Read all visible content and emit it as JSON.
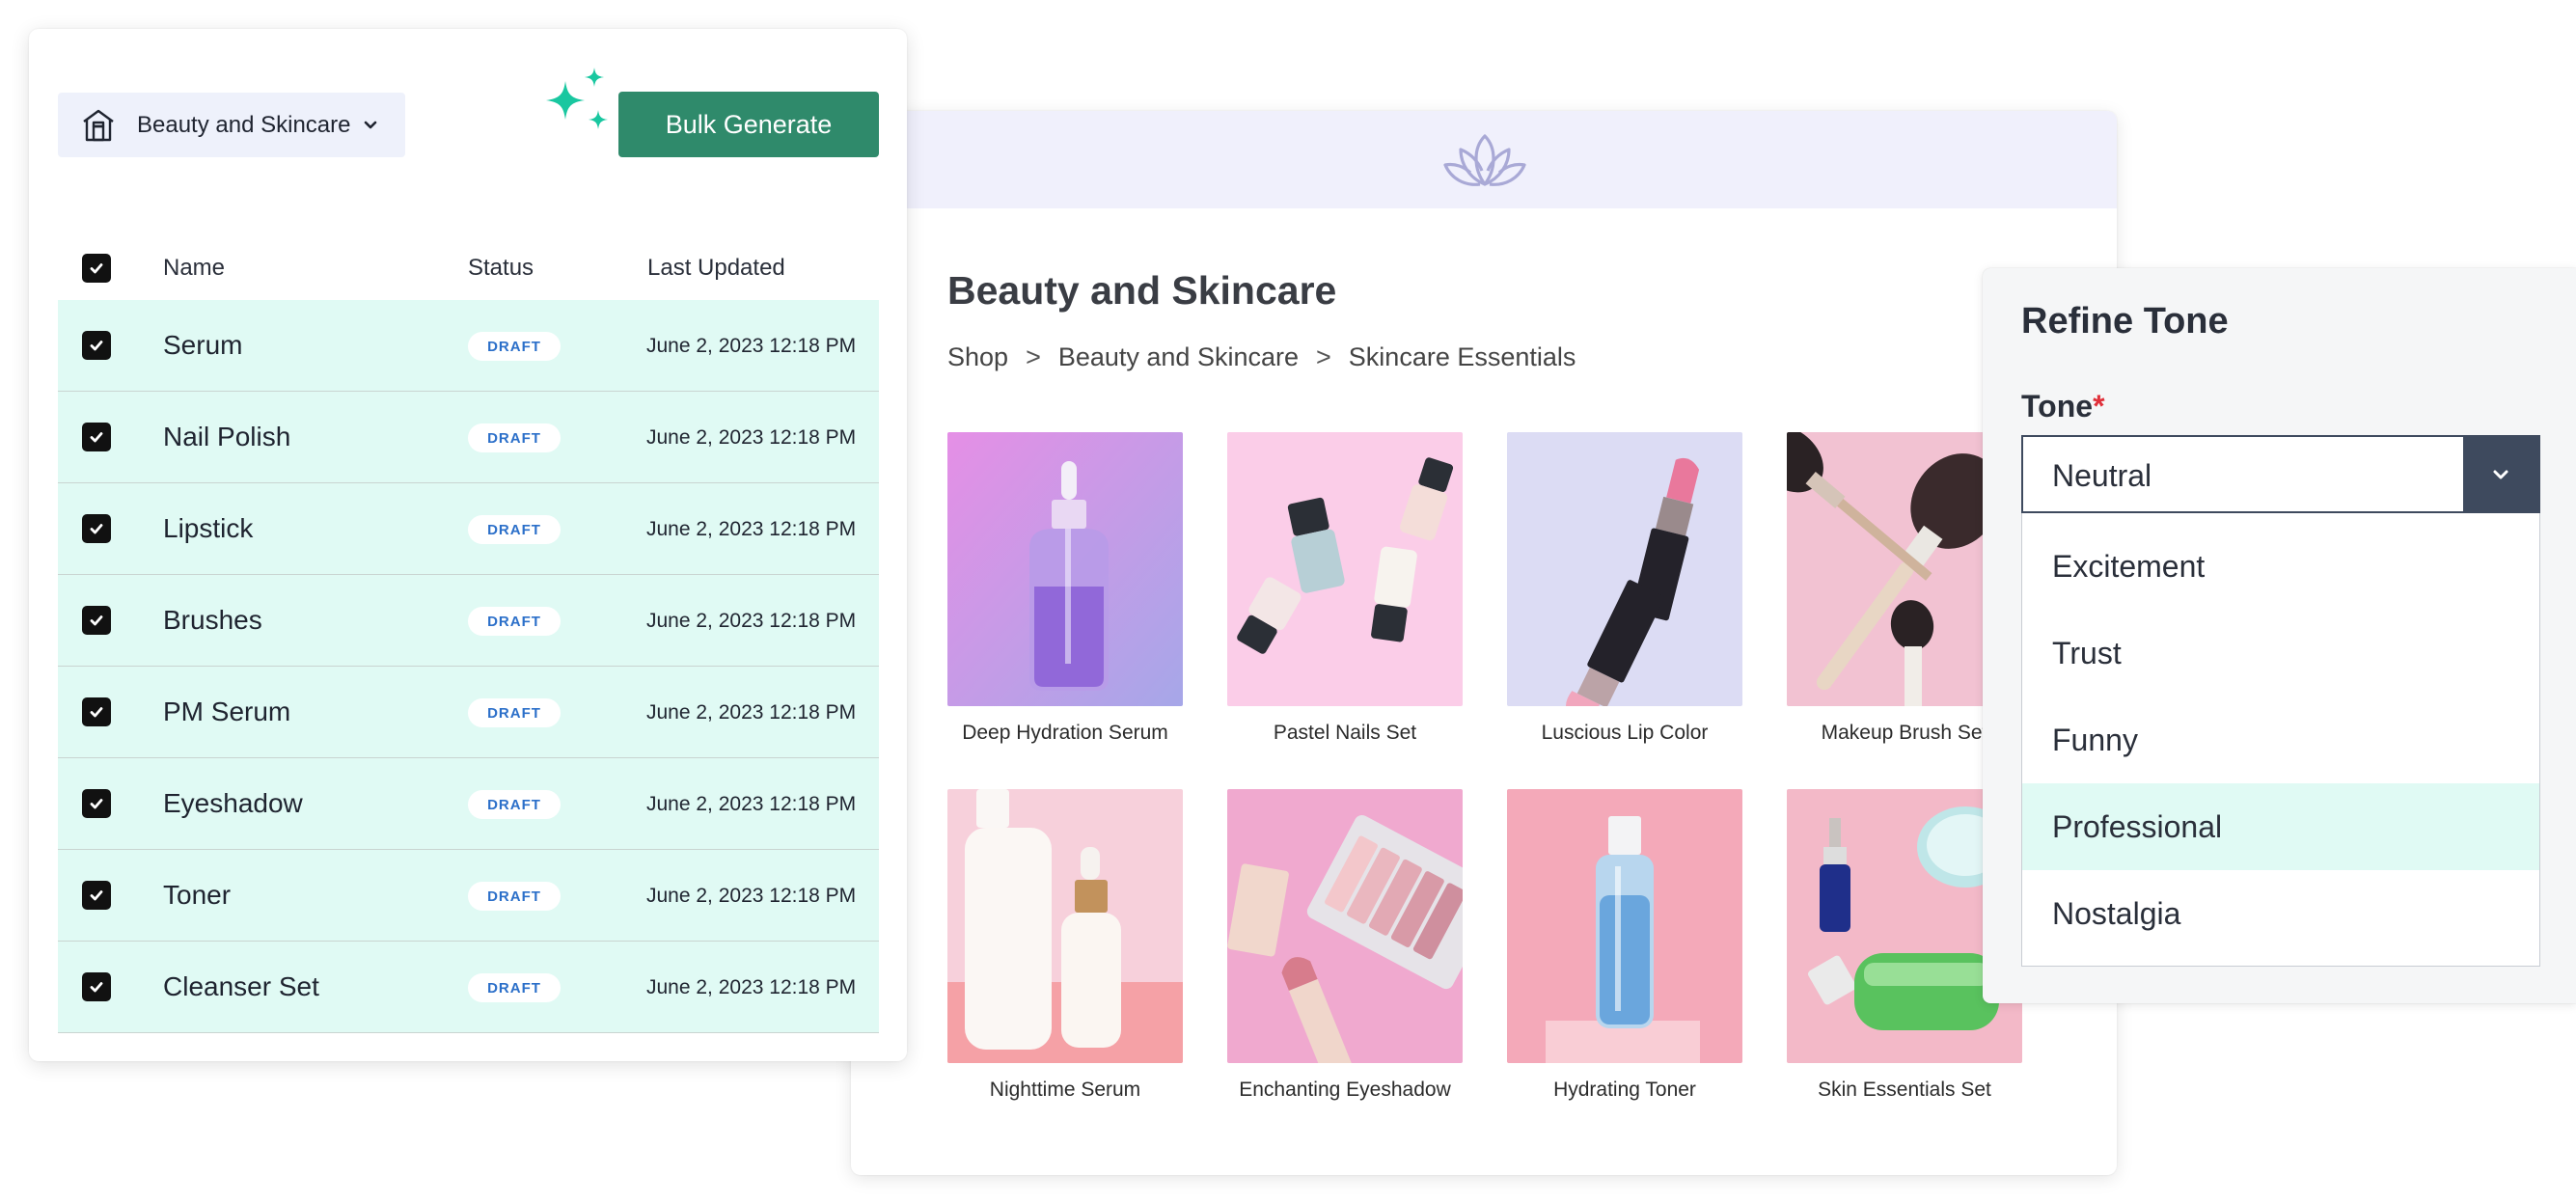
{
  "product_list": {
    "store_select": {
      "label": "Beauty and Skincare"
    },
    "bulk_generate_label": "Bulk Generate",
    "columns": {
      "name": "Name",
      "status": "Status",
      "last_updated": "Last Updated"
    },
    "rows": [
      {
        "name": "Serum",
        "status": "DRAFT",
        "updated": "June 2, 2023  12:18 PM"
      },
      {
        "name": "Nail Polish",
        "status": "DRAFT",
        "updated": "June 2, 2023  12:18 PM"
      },
      {
        "name": "Lipstick",
        "status": "DRAFT",
        "updated": "June 2, 2023  12:18 PM"
      },
      {
        "name": "Brushes",
        "status": "DRAFT",
        "updated": "June 2, 2023  12:18 PM"
      },
      {
        "name": "PM Serum",
        "status": "DRAFT",
        "updated": "June 2, 2023  12:18 PM"
      },
      {
        "name": "Eyeshadow",
        "status": "DRAFT",
        "updated": "June 2, 2023  12:18 PM"
      },
      {
        "name": "Toner",
        "status": "DRAFT",
        "updated": "June 2, 2023  12:18 PM"
      },
      {
        "name": "Cleanser Set",
        "status": "DRAFT",
        "updated": "June 2, 2023  12:18 PM"
      }
    ]
  },
  "shop": {
    "title": "Beauty and Skincare",
    "breadcrumb": [
      "Shop",
      "Beauty and Skincare",
      "Skincare Essentials"
    ],
    "breadcrumb_separator": ">",
    "products": [
      {
        "label": "Deep Hydration Serum"
      },
      {
        "label": "Pastel Nails Set"
      },
      {
        "label": "Luscious Lip Color"
      },
      {
        "label": "Makeup Brush Set"
      },
      {
        "label": "Nighttime Serum"
      },
      {
        "label": "Enchanting Eyeshadow"
      },
      {
        "label": "Hydrating Toner"
      },
      {
        "label": "Skin Essentials Set"
      }
    ]
  },
  "tone_panel": {
    "title": "Refine Tone",
    "field_label": "Tone",
    "required_mark": "*",
    "selected": "Neutral",
    "options": [
      "Excitement",
      "Trust",
      "Funny",
      "Professional",
      "Nostalgia"
    ],
    "highlighted_option": "Professional"
  },
  "colors": {
    "accent_green": "#2f8a6b",
    "row_highlight": "#e0faf4",
    "badge_text": "#2b6fc9",
    "banner": "#f0f0fc",
    "select_dark": "#3e4a5e",
    "sparkle": "#19c7a0"
  }
}
